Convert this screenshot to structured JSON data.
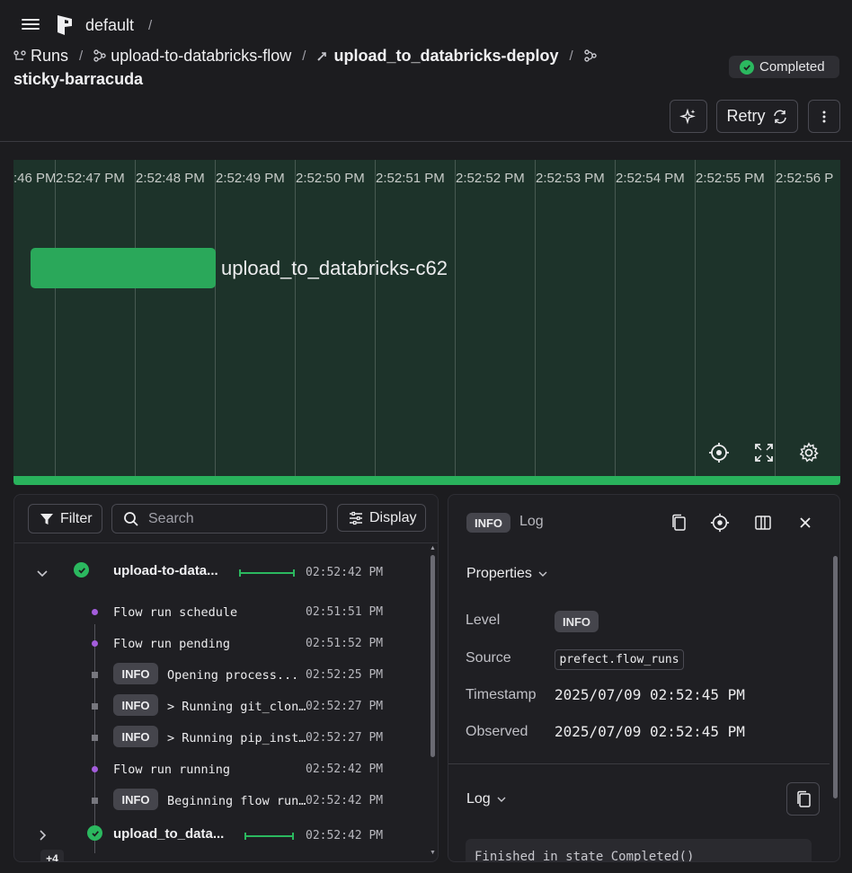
{
  "header": {
    "workspace": "default",
    "workspace_sep": "/",
    "breadcrumbs": [
      {
        "label": "Runs",
        "icon": "runs-icon"
      },
      {
        "label": "upload-to-databricks-flow",
        "icon": "flow-icon"
      },
      {
        "label": "upload_to_databricks-deploy",
        "icon": "deployment-icon"
      }
    ],
    "separator": "/",
    "run_name": "sticky-barracuda",
    "status": "Completed",
    "retry_label": "Retry",
    "colors": {
      "success": "#2bb85f",
      "background": "#1c1c1f"
    }
  },
  "timeline": {
    "ticks": [
      ":46 PM",
      "2:52:47 PM",
      "2:52:48 PM",
      "2:52:49 PM",
      "2:52:50 PM",
      "2:52:51 PM",
      "2:52:52 PM",
      "2:52:53 PM",
      "2:52:54 PM",
      "2:52:55 PM",
      "2:52:56 P"
    ],
    "bar_label": "upload_to_databricks-c62",
    "controls": [
      "target-icon",
      "expand-icon",
      "settings-icon"
    ]
  },
  "logs_panel": {
    "filter_label": "Filter",
    "search_placeholder": "Search",
    "display_label": "Display",
    "flow_rows": [
      {
        "name": "upload-to-data...",
        "time": "02:52:42 PM"
      },
      {
        "name": "upload_to_data...",
        "time": "02:52:42 PM",
        "extra_badge": "+4"
      }
    ],
    "entries": [
      {
        "kind": "state",
        "text": "Flow run schedule",
        "time": "02:51:51 PM"
      },
      {
        "kind": "state",
        "text": "Flow run pending",
        "time": "02:51:52 PM"
      },
      {
        "kind": "log",
        "level": "INFO",
        "text": "Opening process...",
        "time": "02:52:25 PM"
      },
      {
        "kind": "log",
        "level": "INFO",
        "text": "> Running git_clon…",
        "time": "02:52:27 PM"
      },
      {
        "kind": "log",
        "level": "INFO",
        "text": "> Running pip_inst…",
        "time": "02:52:27 PM"
      },
      {
        "kind": "state",
        "text": "Flow run running",
        "time": "02:52:42 PM"
      },
      {
        "kind": "log",
        "level": "INFO",
        "text": "Beginning flow run…",
        "time": "02:52:42 PM"
      }
    ]
  },
  "detail_panel": {
    "level_badge": "INFO",
    "title": "Log",
    "properties_label": "Properties",
    "properties": {
      "level_label": "Level",
      "level_value": "INFO",
      "source_label": "Source",
      "source_value": "prefect.flow_runs",
      "timestamp_label": "Timestamp",
      "timestamp_value": "2025/07/09 02:52:45 PM",
      "observed_label": "Observed",
      "observed_value": "2025/07/09 02:52:45 PM"
    },
    "log_label": "Log",
    "log_text": "Finished in state Completed()"
  }
}
